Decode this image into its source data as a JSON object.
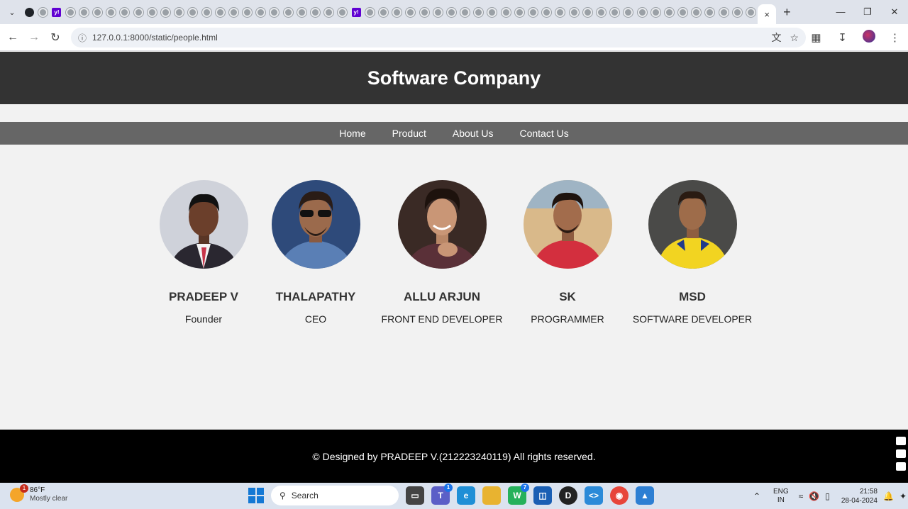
{
  "browser": {
    "url": "127.0.0.1:8000/static/people.html",
    "active_tab_close": "×",
    "new_tab": "+"
  },
  "site": {
    "title": "Software Company",
    "nav": [
      "Home",
      "Product",
      "About Us",
      "Contact Us"
    ],
    "people": [
      {
        "name": "PRADEEP V",
        "role": "Founder"
      },
      {
        "name": "THALAPATHY",
        "role": "CEO"
      },
      {
        "name": "ALLU ARJUN",
        "role": "FRONT END DEVELOPER"
      },
      {
        "name": "SK",
        "role": "PROGRAMMER"
      },
      {
        "name": "MSD",
        "role": "SOFTWARE DEVELOPER"
      }
    ],
    "footer": "© Designed by PRADEEP V.(212223240119) All rights reserved."
  },
  "taskbar": {
    "weather_temp": "86°F",
    "weather_desc": "Mostly clear",
    "weather_badge": "1",
    "search_placeholder": "Search",
    "teams_badge": "1",
    "whatsapp_badge": "7",
    "lang_1": "ENG",
    "lang_2": "IN",
    "time": "21:58",
    "date": "28-04-2024"
  }
}
